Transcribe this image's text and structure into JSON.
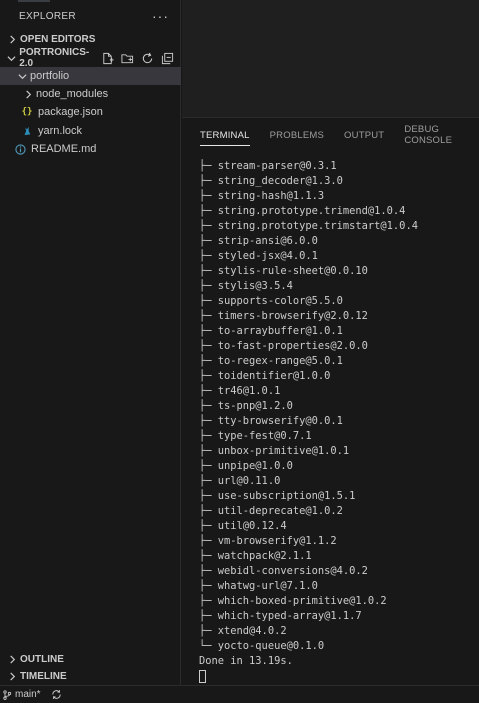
{
  "sidebar": {
    "title": "EXPLORER",
    "more_icon": "more-actions-icon",
    "sections": {
      "open_editors": "OPEN EDITORS",
      "workspace": "PORTRONICS-2.0",
      "outline": "OUTLINE",
      "timeline": "TIMELINE"
    },
    "toolbar_icons": [
      "new-file-icon",
      "new-folder-icon",
      "refresh-icon",
      "collapse-all-icon"
    ],
    "tree": [
      {
        "label": "portfolio",
        "icon": "chevron-down-icon",
        "selected": true
      },
      {
        "label": "node_modules",
        "icon": "chevron-right-icon"
      },
      {
        "label": "package.json",
        "icon": "json-icon",
        "glyph": "{}"
      },
      {
        "label": "yarn.lock",
        "icon": "yarn-icon"
      },
      {
        "label": "README.md",
        "icon": "info-icon"
      }
    ]
  },
  "panel": {
    "tabs": [
      "TERMINAL",
      "PROBLEMS",
      "OUTPUT",
      "DEBUG CONSOLE"
    ],
    "active_tab": "TERMINAL",
    "terminal_lines": [
      "├─ stream-parser@0.3.1",
      "├─ string_decoder@1.3.0",
      "├─ string-hash@1.1.3",
      "├─ string.prototype.trimend@1.0.4",
      "├─ string.prototype.trimstart@1.0.4",
      "├─ strip-ansi@6.0.0",
      "├─ styled-jsx@4.0.1",
      "├─ stylis-rule-sheet@0.0.10",
      "├─ stylis@3.5.4",
      "├─ supports-color@5.5.0",
      "├─ timers-browserify@2.0.12",
      "├─ to-arraybuffer@1.0.1",
      "├─ to-fast-properties@2.0.0",
      "├─ to-regex-range@5.0.1",
      "├─ toidentifier@1.0.0",
      "├─ tr46@1.0.1",
      "├─ ts-pnp@1.2.0",
      "├─ tty-browserify@0.0.1",
      "├─ type-fest@0.7.1",
      "├─ unbox-primitive@1.0.1",
      "├─ unpipe@1.0.0",
      "├─ url@0.11.0",
      "├─ use-subscription@1.5.1",
      "├─ util-deprecate@1.0.2",
      "├─ util@0.12.4",
      "├─ vm-browserify@1.1.2",
      "├─ watchpack@2.1.1",
      "├─ webidl-conversions@4.0.2",
      "├─ whatwg-url@7.1.0",
      "├─ which-boxed-primitive@1.0.2",
      "├─ which-typed-array@1.1.7",
      "├─ xtend@4.0.2",
      "└─ yocto-queue@0.1.0",
      "Done in 13.19s."
    ]
  },
  "statusbar": {
    "branch": "main*",
    "branch_icon": "git-branch-icon",
    "sync_icon": "sync-icon"
  },
  "colors": {
    "background": "#181818",
    "editor": "#1f1f1f",
    "selected": "#37373d",
    "json_icon": "#cbcb41",
    "yarn_icon": "#2c8ebb",
    "info_icon": "#519aba"
  }
}
